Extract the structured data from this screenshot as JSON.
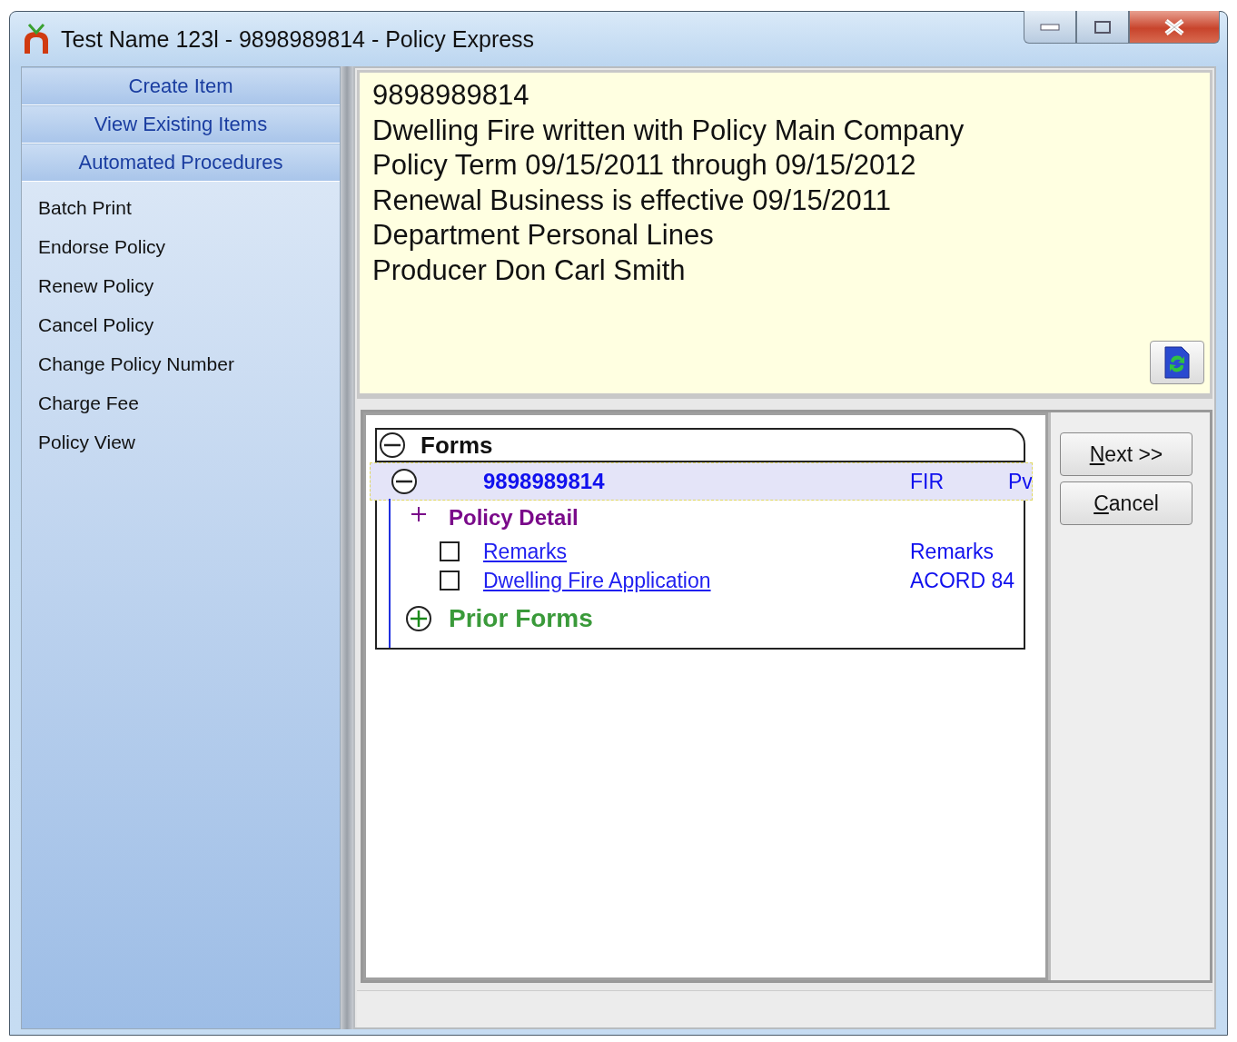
{
  "window": {
    "title": "Test Name 123l - 9898989814 - Policy Express"
  },
  "nav_buttons": [
    "Create Item",
    "View Existing Items",
    "Automated Procedures"
  ],
  "procedures": [
    "Batch Print",
    "Endorse Policy",
    "Renew Policy",
    "Cancel Policy",
    "Change Policy Number",
    "Charge Fee",
    "Policy View"
  ],
  "info": {
    "lines": [
      "9898989814",
      "Dwelling Fire written with Policy Main Company",
      "Policy Term 09/15/2011 through 09/15/2012",
      "Renewal Business is effective 09/15/2011",
      "Department Personal Lines",
      "Producer Don Carl Smith"
    ]
  },
  "tree": {
    "header": {
      "label": "Forms",
      "expanded": true
    },
    "nodes": [
      {
        "label": "9898989814",
        "column_2": "FIR",
        "column_3": "Pv",
        "selected": true,
        "expanded": true,
        "children": [
          {
            "kind": "group",
            "label": "Policy Detail"
          },
          {
            "kind": "form",
            "label": "Remarks",
            "code": "Remarks",
            "checked": false
          },
          {
            "kind": "form",
            "label": "Dwelling Fire Application",
            "code": "ACORD 84",
            "checked": false
          },
          {
            "kind": "section",
            "label": "Prior Forms",
            "expanded": false
          }
        ]
      }
    ]
  },
  "buttons": [
    "Next >>",
    "Cancel"
  ]
}
